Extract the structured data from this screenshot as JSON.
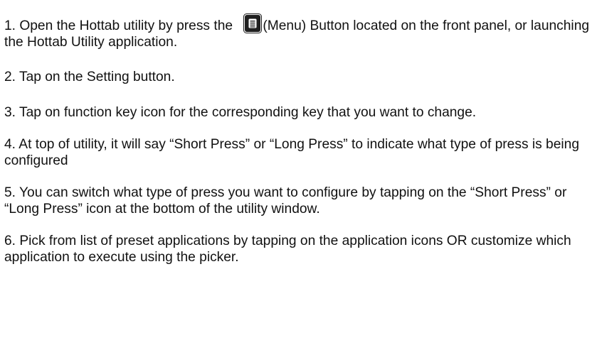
{
  "steps": [
    {
      "pre": "1. Open the Hottab utility by press the ",
      "post": "(Menu) Button located on the front panel, or launching the Hottab Utility application."
    },
    {
      "text": "2. Tap on the Setting button."
    },
    {
      "text": "3. Tap on function key icon for the corresponding key that you want to change."
    },
    {
      "text": "4. At top of utility, it will say “Short Press” or “Long Press” to indicate what type of press is being configured"
    },
    {
      "text": "5. You can switch what type of press you want to configure by tapping on the “Short Press” or “Long Press” icon at the bottom of the utility window."
    },
    {
      "text": "6. Pick from list of preset applications by tapping on the application icons OR customize which application to execute using the picker."
    }
  ],
  "icons": {
    "menu_icon": "menu-button-icon"
  }
}
